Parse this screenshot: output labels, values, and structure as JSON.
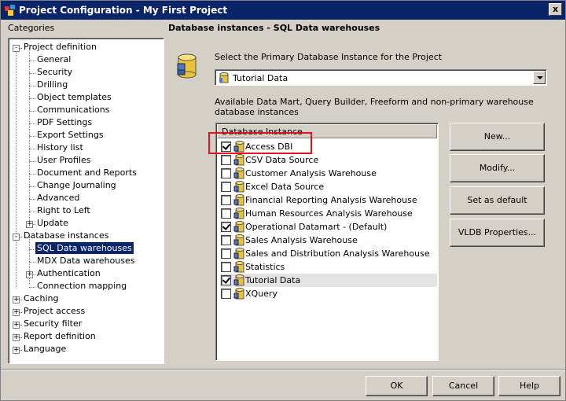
{
  "window": {
    "title": "Project Configuration - My First Project",
    "close_glyph": "x"
  },
  "categories": {
    "label": "Categories",
    "tree": [
      {
        "label": "Project definition",
        "expander": "-"
      },
      {
        "label": "General"
      },
      {
        "label": "Security"
      },
      {
        "label": "Drilling"
      },
      {
        "label": "Object templates"
      },
      {
        "label": "Communications"
      },
      {
        "label": "PDF Settings"
      },
      {
        "label": "Export Settings"
      },
      {
        "label": "History list"
      },
      {
        "label": "User Profiles"
      },
      {
        "label": "Document and Reports"
      },
      {
        "label": "Change Journaling"
      },
      {
        "label": "Advanced"
      },
      {
        "label": "Right to Left"
      },
      {
        "label": "Update",
        "expander": "+"
      },
      {
        "label": "Database instances",
        "expander": "-"
      },
      {
        "label": "SQL Data warehouses",
        "selected": true
      },
      {
        "label": "MDX Data warehouses"
      },
      {
        "label": "Authentication",
        "expander": "+"
      },
      {
        "label": "Connection mapping"
      },
      {
        "label": "Caching",
        "expander": "+"
      },
      {
        "label": "Project access",
        "expander": "+"
      },
      {
        "label": "Security filter",
        "expander": "+"
      },
      {
        "label": "Report definition",
        "expander": "+"
      },
      {
        "label": "Language",
        "expander": "+"
      }
    ]
  },
  "main": {
    "title": "Database instances - SQL Data warehouses",
    "primary_label": "Select the Primary Database Instance for the Project",
    "primary_value": "Tutorial Data",
    "available_label": "Available Data Mart, Query Builder, Freeform and non-primary warehouse database instances",
    "list_header": "Database Instance",
    "instances": [
      {
        "label": "Access DBI",
        "checked": true
      },
      {
        "label": "CSV Data Source",
        "checked": false
      },
      {
        "label": "Customer Analysis Warehouse",
        "checked": false
      },
      {
        "label": "Excel Data Source",
        "checked": false
      },
      {
        "label": "Financial Reporting Analysis Warehouse",
        "checked": false
      },
      {
        "label": "Human Resources Analysis Warehouse",
        "checked": false
      },
      {
        "label": "Operational Datamart - (Default)",
        "checked": true
      },
      {
        "label": "Sales Analysis Warehouse",
        "checked": false
      },
      {
        "label": "Sales and Distribution Analysis Warehouse",
        "checked": false
      },
      {
        "label": "Statistics",
        "checked": false
      },
      {
        "label": "Tutorial Data",
        "checked": true,
        "highlighted": true
      },
      {
        "label": "XQuery",
        "checked": false
      }
    ],
    "side_buttons": {
      "new": "New...",
      "modify": "Modify...",
      "set_default": "Set as default",
      "vldb": "VLDB Properties..."
    }
  },
  "footer": {
    "ok": "OK",
    "cancel": "Cancel",
    "help": "Help"
  },
  "colors": {
    "titlebar": "#0a246a",
    "annotation_box": "#e0141e",
    "face": "#d4d0c8"
  }
}
